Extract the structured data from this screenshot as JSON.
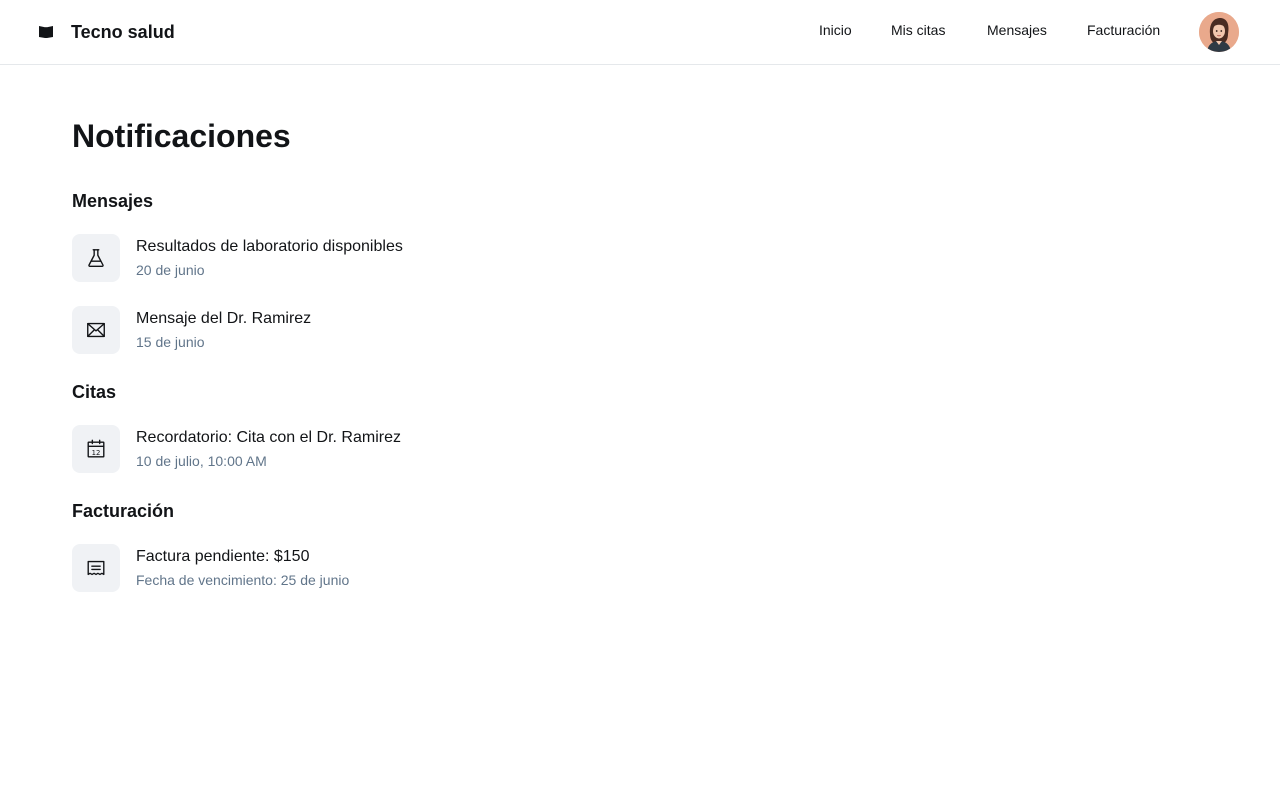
{
  "app": {
    "title": "Tecno salud",
    "logo_icon": "book-icon"
  },
  "nav": {
    "items": [
      {
        "label": "Inicio"
      },
      {
        "label": "Mis citas"
      },
      {
        "label": "Mensajes"
      },
      {
        "label": "Facturación"
      }
    ],
    "avatar_icon": "user-avatar"
  },
  "page": {
    "title": "Notificaciones"
  },
  "sections": [
    {
      "title": "Mensajes",
      "items": [
        {
          "title": "Resultados de laboratorio disponibles",
          "subtitle": "20 de junio",
          "icon": "flask-icon"
        },
        {
          "title": "Mensaje del Dr. Ramirez",
          "subtitle": "15 de junio",
          "icon": "envelope-icon"
        }
      ]
    },
    {
      "title": "Citas",
      "items": [
        {
          "title": "Recordatorio: Cita con el Dr. Ramirez",
          "subtitle": "10 de julio, 10:00 AM",
          "icon": "calendar-icon"
        }
      ]
    },
    {
      "title": "Facturación",
      "items": [
        {
          "title": "Factura pendiente: $150",
          "subtitle": "Fecha de vencimiento: 25 de junio",
          "icon": "receipt-icon"
        }
      ]
    }
  ],
  "colors": {
    "text_primary": "#121417",
    "text_secondary": "#61758a",
    "icon_background": "#f0f2f5",
    "divider": "#e5e8eb"
  }
}
